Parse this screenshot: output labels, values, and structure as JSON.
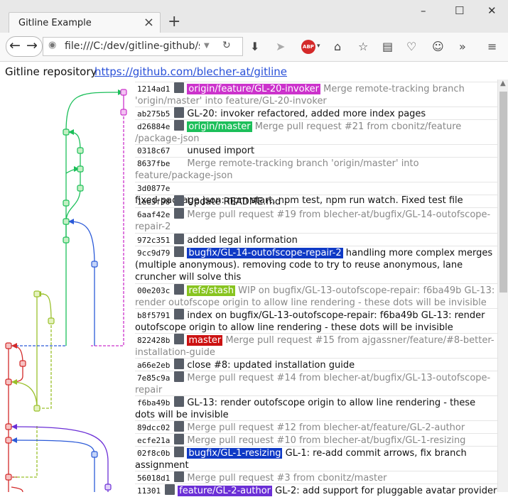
{
  "browser": {
    "tab_title": "Gitline Example",
    "url": "file:///C:/dev/gitline-github/src",
    "window_controls": [
      "–",
      "☐",
      "✕"
    ]
  },
  "page": {
    "title": "Gitline repository",
    "link": "https://github.com/blecher-at/gitline"
  },
  "commits": [
    {
      "hash": "1214ad1",
      "ref": "origin/feature/GL-20-invoker",
      "ref_color": "#cc33cc",
      "message": "Merge remote-tracking branch 'origin/master' into feature/GL-20-invoker",
      "merge": true,
      "avatar": true
    },
    {
      "hash": "ab275b5",
      "ref": "",
      "message": "GL-20: invoker refactored, added more index pages",
      "merge": false,
      "avatar": true
    },
    {
      "hash": "d26884e",
      "ref": "origin/master",
      "ref_color": "#1cbf5a",
      "message": "Merge pull request #21 from cbonitz/feature /package-json",
      "merge": true,
      "avatar": true
    },
    {
      "hash": "0318c67",
      "ref": "",
      "message": "unused import",
      "merge": false,
      "avatar": false
    },
    {
      "hash": "8637fbe",
      "ref": "",
      "message": "Merge remote-tracking branch 'origin/master' into feature/package-json",
      "merge": true,
      "avatar": false
    },
    {
      "hash": "3d0877e",
      "ref": "",
      "message": "fixed package.json: npm start, npm test, npm run watch. Fixed test file",
      "merge": false,
      "avatar": false
    },
    {
      "hash": "1ee3f98",
      "ref": "",
      "message": "Update README.md",
      "merge": false,
      "avatar": true
    },
    {
      "hash": "6aaf42e",
      "ref": "",
      "message": "Merge pull request #19 from blecher-at/bugfix/GL-14-outofscope-repair-2",
      "merge": true,
      "avatar": true
    },
    {
      "hash": "972c351",
      "ref": "",
      "message": "added legal information",
      "merge": false,
      "avatar": true
    },
    {
      "hash": "9cc9d79",
      "ref": "bugfix/GL-14-outofscope-repair-2",
      "ref_color": "#0f3ac6",
      "message": "handling more complex merges (multiple anonymous). removing code to try to reuse anonymous, lane cruncher will solve this",
      "merge": false,
      "avatar": true
    },
    {
      "hash": "00e203c",
      "ref": "refs/stash",
      "ref_color": "#88c420",
      "message": "WIP on bugfix/GL-13-outofscope-repair: f6ba49b GL-13: render outofscope origin to allow line rendering - these dots will be invisible",
      "merge": true,
      "avatar": true
    },
    {
      "hash": "b8f5791",
      "ref": "",
      "message": "index on bugfix/GL-13-outofscope-repair: f6ba49b GL-13: render outofscope origin to allow line rendering - these dots will be invisible",
      "merge": false,
      "avatar": true
    },
    {
      "hash": "822428b",
      "ref": "master",
      "ref_color": "#cc1111",
      "message": "Merge pull request #15 from ajgassner/feature/#8-better-installation-guide",
      "merge": true,
      "avatar": true
    },
    {
      "hash": "a66e2eb",
      "ref": "",
      "message": "close #8: updated installation guide",
      "merge": false,
      "avatar": true
    },
    {
      "hash": "7e85c9a",
      "ref": "",
      "message": "Merge pull request #14 from blecher-at/bugfix/GL-13-outofscope-repair",
      "merge": true,
      "avatar": true
    },
    {
      "hash": "f6ba49b",
      "ref": "",
      "message": "GL-13: render outofscope origin to allow line rendering - these dots will be invisible",
      "merge": false,
      "avatar": true
    },
    {
      "hash": "89dcc02",
      "ref": "",
      "message": "Merge pull request #12 from blecher-at/feature/GL-2-author",
      "merge": true,
      "avatar": true
    },
    {
      "hash": "ecfe21a",
      "ref": "",
      "message": "Merge pull request #10 from blecher-at/bugfix/GL-1-resizing",
      "merge": true,
      "avatar": true
    },
    {
      "hash": "02f8c0b",
      "ref": "bugfix/GL-1-resizing",
      "ref_color": "#0f3ac6",
      "message": "GL-1: re-add commit arrows, fix branch assignment",
      "merge": false,
      "avatar": true
    },
    {
      "hash": "56018d1",
      "ref": "",
      "message": "Merge pull request #3 from cbonitz/master",
      "merge": true,
      "avatar": true
    },
    {
      "hash": "11301",
      "ref": "feature/GL-2-author",
      "ref_color": "#6b2fd6",
      "message": "GL-2: add support for pluggable avatar provider",
      "merge": false,
      "avatar": true
    }
  ]
}
